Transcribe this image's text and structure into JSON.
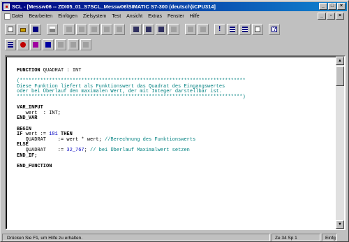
{
  "window": {
    "title": "SCL - [Messw06 -- ZDI05_01_S7SCL_Messw06\\SIMATIC S7-300 (deutsch)\\CPU314]",
    "controls": {
      "minimize": "_",
      "maximize": "□",
      "close": "×"
    }
  },
  "menubar": {
    "items": [
      "Datei",
      "Bearbeiten",
      "Einfügen",
      "Zielsystem",
      "Test",
      "Ansicht",
      "Extras",
      "Fenster",
      "Hilfe"
    ],
    "doc_controls": {
      "minimize": "_",
      "restore": "▫",
      "close": "×"
    }
  },
  "toolbar1": {
    "icons": [
      "new-file-icon",
      "open-folder-icon",
      "save-icon",
      "print-icon",
      "undo-icon",
      "redo-icon",
      "cut-icon",
      "copy-icon",
      "paste-icon",
      "find-icon",
      "replace-icon",
      "find-next-icon",
      "bookmark-icon",
      "goto-icon",
      "indent-icon",
      "compile-icon",
      "download-icon",
      "monitor-icon",
      "breakpoint-icon",
      "help-icon"
    ]
  },
  "toolbar2": {
    "icons": [
      "list-icon",
      "breakpoint-set-icon",
      "breakpoint-remove-icon",
      "run-icon",
      "step-into-icon",
      "step-over-icon",
      "step-out-icon"
    ]
  },
  "editor": {
    "lines": [
      {
        "parts": [
          {
            "t": "FUNCTION",
            "c": "kw"
          },
          {
            "t": " QUADRAT : INT",
            "c": "var"
          }
        ]
      },
      {
        "parts": [
          {
            "t": "",
            "c": "var"
          }
        ]
      },
      {
        "parts": [
          {
            "t": "(*****************************************************************************",
            "c": "cm"
          }
        ]
      },
      {
        "parts": [
          {
            "t": "Diese Funktion liefert als Funktionswert das Quadrat des Eingangswertes",
            "c": "cm"
          }
        ]
      },
      {
        "parts": [
          {
            "t": "oder bei Überlauf den maximalen Wert, der mit Integer darstellbar ist.",
            "c": "cm"
          }
        ]
      },
      {
        "parts": [
          {
            "t": "*****************************************************************************)",
            "c": "cm"
          }
        ]
      },
      {
        "parts": [
          {
            "t": "",
            "c": "var"
          }
        ]
      },
      {
        "parts": [
          {
            "t": "VAR_INPUT",
            "c": "kw"
          }
        ]
      },
      {
        "parts": [
          {
            "t": "   wert  : INT;",
            "c": "var"
          }
        ]
      },
      {
        "parts": [
          {
            "t": "END_VAR",
            "c": "kw"
          }
        ]
      },
      {
        "parts": [
          {
            "t": "",
            "c": "var"
          }
        ]
      },
      {
        "parts": [
          {
            "t": "BEGIN",
            "c": "kw"
          }
        ]
      },
      {
        "parts": [
          {
            "t": "IF",
            "c": "kw"
          },
          {
            "t": " wert := ",
            "c": "var"
          },
          {
            "t": "181",
            "c": "num"
          },
          {
            "t": " THEN",
            "c": "kw"
          }
        ]
      },
      {
        "parts": [
          {
            "t": "   QUADRAT    := wert * wert; ",
            "c": "var"
          },
          {
            "t": "//Berechnung des Funktionswerts",
            "c": "cm"
          }
        ]
      },
      {
        "parts": [
          {
            "t": "ELSE",
            "c": "kw"
          }
        ]
      },
      {
        "parts": [
          {
            "t": "   QUADRAT    := ",
            "c": "var"
          },
          {
            "t": "32_767",
            "c": "num"
          },
          {
            "t": "; ",
            "c": "var"
          },
          {
            "t": "// bei Überlauf Maximalwert setzen",
            "c": "cm"
          }
        ]
      },
      {
        "parts": [
          {
            "t": "END_IF;",
            "c": "kw"
          }
        ]
      },
      {
        "parts": [
          {
            "t": "",
            "c": "var"
          }
        ]
      },
      {
        "parts": [
          {
            "t": "END_FUNCTION",
            "c": "kw"
          }
        ]
      }
    ]
  },
  "statusbar": {
    "hint": "Drücken Sie F1, um Hilfe zu erhalten.",
    "position": "Ze 34 Sp 1",
    "mode": "Einfg"
  },
  "colors": {
    "title_bar": "#000080",
    "comment": "#008080",
    "number": "#0000c0",
    "chrome": "#c0c0c0"
  }
}
